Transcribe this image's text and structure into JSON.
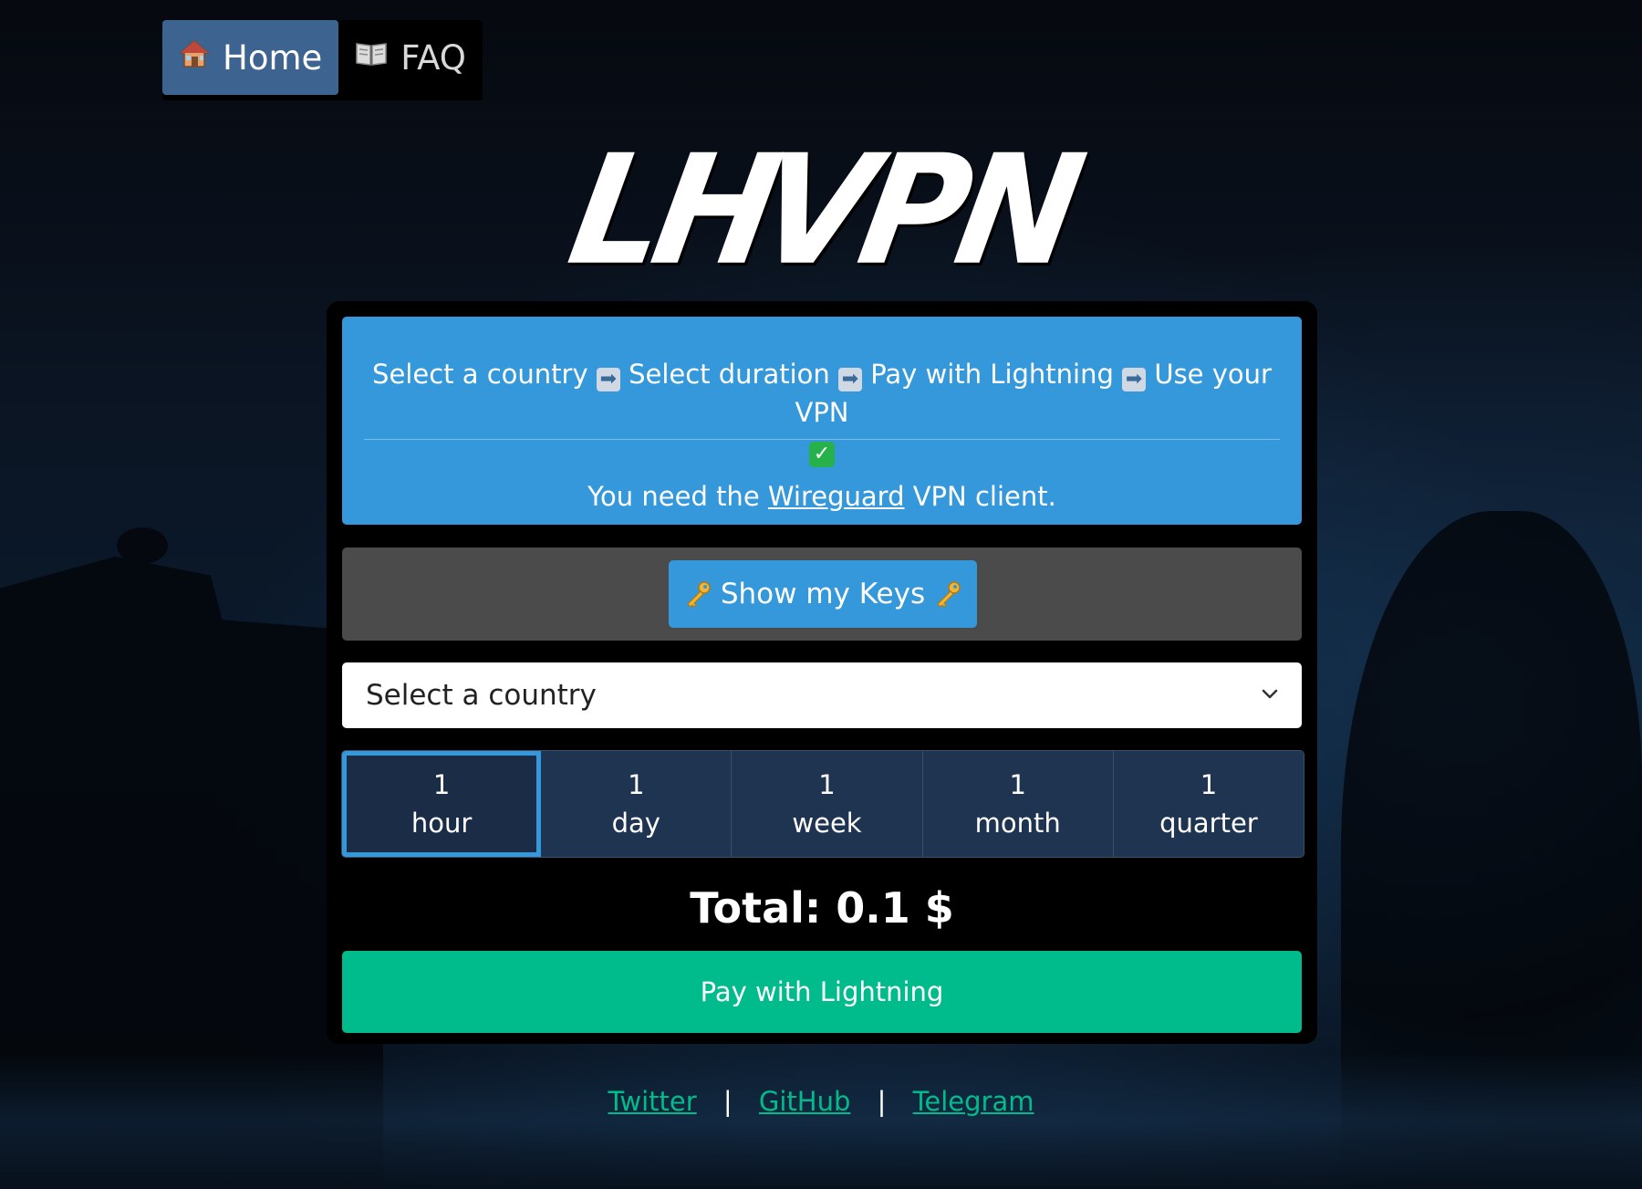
{
  "nav": {
    "items": [
      {
        "label": "Home",
        "icon": "house-icon",
        "active": true
      },
      {
        "label": "FAQ",
        "icon": "book-icon",
        "active": false
      }
    ]
  },
  "logo": {
    "left": "LH",
    "right": "VPN",
    "accent": "#ffc107"
  },
  "info": {
    "step1": "Select a country",
    "step2": "Select duration",
    "step3": "Pay with Lightning",
    "step4": "Use your VPN",
    "wg_prefix": "You need the",
    "wg_link": "Wireguard",
    "wg_suffix": "VPN client."
  },
  "keys_button": {
    "label": "Show my Keys"
  },
  "country_select": {
    "value": "Select a country"
  },
  "durations": [
    {
      "amount": "1",
      "unit": "hour",
      "selected": true
    },
    {
      "amount": "1",
      "unit": "day",
      "selected": false
    },
    {
      "amount": "1",
      "unit": "week",
      "selected": false
    },
    {
      "amount": "1",
      "unit": "month",
      "selected": false
    },
    {
      "amount": "1",
      "unit": "quarter",
      "selected": false
    }
  ],
  "total": "Total: 0.1 $",
  "pay_button": {
    "label": "Pay with Lightning",
    "color": "#00bc8c"
  },
  "footer": {
    "links": [
      "Twitter",
      "GitHub",
      "Telegram"
    ],
    "separator": "|"
  },
  "colors": {
    "primary": "#3498db",
    "success": "#00bc8c",
    "nav_active": "#3d6391"
  }
}
